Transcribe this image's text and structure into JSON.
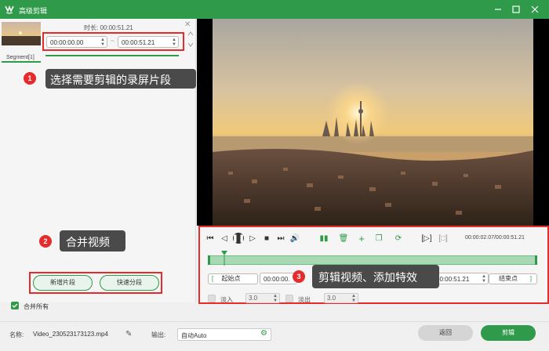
{
  "window": {
    "title": "高级剪辑"
  },
  "segment": {
    "label": "Segment[1]",
    "duration_label": "时长:",
    "duration_value": "00:00:51.21",
    "start_time": "00:00:00.00",
    "end_time": "00:00:51.21",
    "separator": "~"
  },
  "callouts": [
    {
      "number": "1",
      "text": "选择需要剪辑的录屏片段"
    },
    {
      "number": "2",
      "text": "合并视频"
    },
    {
      "number": "3",
      "text": "剪辑视频、添加特效"
    }
  ],
  "left_buttons": {
    "new_segment": "新增片段",
    "fast_split": "快速分段"
  },
  "merge_all": {
    "label": "合并所有",
    "checked": true
  },
  "player": {
    "time_readout": "00:00:02.07/00:00:51.21",
    "start_point_label": "起始点",
    "start_time": "00:00:00.",
    "end_time": "00:00:51.21",
    "end_point_label": "结束点",
    "fade_in_label": "淡入",
    "fade_in_value": "3.0",
    "fade_out_label": "淡出",
    "fade_out_value": "3.0",
    "bracket_left": "[",
    "bracket_right": "]"
  },
  "footer": {
    "name_label": "名称:",
    "name_value": "Video_230523173123.mp4",
    "output_label": "输出:",
    "output_value": "自动Auto",
    "back_button": "返回",
    "cut_button": "剪辑"
  },
  "colors": {
    "accent": "#2e9a4a",
    "highlight": "#e52b2b",
    "callout_bg": "#4a4a4a"
  }
}
